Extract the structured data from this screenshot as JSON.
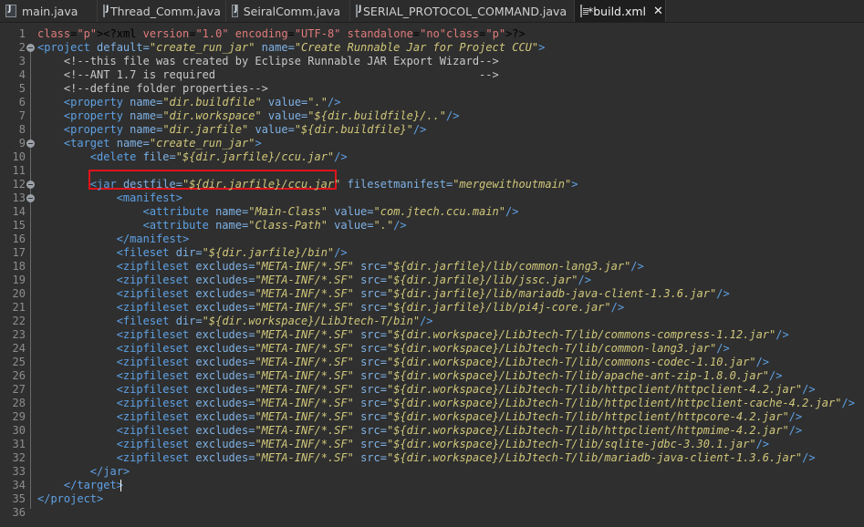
{
  "tabs": [
    {
      "label": "main.java",
      "icon": "java-file-icon"
    },
    {
      "label": "Thread_Comm.java",
      "icon": "java-file-icon"
    },
    {
      "label": "SeiralComm.java",
      "icon": "java-file-icon"
    },
    {
      "label": "SERIAL_PROTOCOL_COMMAND.java",
      "icon": "java-file-icon"
    },
    {
      "label": "*build.xml",
      "icon": "xml-file-icon",
      "active": true
    }
  ],
  "lines": [
    {
      "n": "1",
      "code": "<?xml version=\"1.0\" encoding=\"UTF-8\" standalone=\"no\"?>"
    },
    {
      "n": "2",
      "code": "<project default=\"create_run_jar\" name=\"Create Runnable Jar for Project CCU\">"
    },
    {
      "n": "3",
      "code": "    <!--this file was created by Eclipse Runnable JAR Export Wizard-->"
    },
    {
      "n": "4",
      "code": "    <!--ANT 1.7 is required                                        -->"
    },
    {
      "n": "5",
      "code": "    <!--define folder properties-->"
    },
    {
      "n": "6",
      "code": "    <property name=\"dir.buildfile\" value=\".\"/>"
    },
    {
      "n": "7",
      "code": "    <property name=\"dir.workspace\" value=\"${dir.buildfile}/..\"/>"
    },
    {
      "n": "8",
      "code": "    <property name=\"dir.jarfile\" value=\"${dir.buildfile}\"/>"
    },
    {
      "n": "9",
      "code": "    <target name=\"create_run_jar\">"
    },
    {
      "n": "10",
      "code": "        <delete file=\"${dir.jarfile}/ccu.jar\"/>"
    },
    {
      "n": "11",
      "code": ""
    },
    {
      "n": "12",
      "code": "        <jar destfile=\"${dir.jarfile}/ccu.jar\" filesetmanifest=\"mergewithoutmain\">"
    },
    {
      "n": "13",
      "code": "            <manifest>"
    },
    {
      "n": "14",
      "code": "                <attribute name=\"Main-Class\" value=\"com.jtech.ccu.main\"/>"
    },
    {
      "n": "15",
      "code": "                <attribute name=\"Class-Path\" value=\".\"/>"
    },
    {
      "n": "16",
      "code": "            </manifest>"
    },
    {
      "n": "17",
      "code": "            <fileset dir=\"${dir.jarfile}/bin\"/>"
    },
    {
      "n": "18",
      "code": "            <zipfileset excludes=\"META-INF/*.SF\" src=\"${dir.jarfile}/lib/common-lang3.jar\"/>"
    },
    {
      "n": "19",
      "code": "            <zipfileset excludes=\"META-INF/*.SF\" src=\"${dir.jarfile}/lib/jssc.jar\"/>"
    },
    {
      "n": "20",
      "code": "            <zipfileset excludes=\"META-INF/*.SF\" src=\"${dir.jarfile}/lib/mariadb-java-client-1.3.6.jar\"/>"
    },
    {
      "n": "21",
      "code": "            <zipfileset excludes=\"META-INF/*.SF\" src=\"${dir.jarfile}/lib/pi4j-core.jar\"/>"
    },
    {
      "n": "22",
      "code": "            <fileset dir=\"${dir.workspace}/LibJtech-T/bin\"/>"
    },
    {
      "n": "23",
      "code": "            <zipfileset excludes=\"META-INF/*.SF\" src=\"${dir.workspace}/LibJtech-T/lib/commons-compress-1.12.jar\"/>"
    },
    {
      "n": "24",
      "code": "            <zipfileset excludes=\"META-INF/*.SF\" src=\"${dir.workspace}/LibJtech-T/lib/common-lang3.jar\"/>"
    },
    {
      "n": "25",
      "code": "            <zipfileset excludes=\"META-INF/*.SF\" src=\"${dir.workspace}/LibJtech-T/lib/commons-codec-1.10.jar\"/>"
    },
    {
      "n": "26",
      "code": "            <zipfileset excludes=\"META-INF/*.SF\" src=\"${dir.workspace}/LibJtech-T/lib/apache-ant-zip-1.8.0.jar\"/>"
    },
    {
      "n": "27",
      "code": "            <zipfileset excludes=\"META-INF/*.SF\" src=\"${dir.workspace}/LibJtech-T/lib/httpclient/httpclient-4.2.jar\"/>"
    },
    {
      "n": "28",
      "code": "            <zipfileset excludes=\"META-INF/*.SF\" src=\"${dir.workspace}/LibJtech-T/lib/httpclient/httpclient-cache-4.2.jar\"/>"
    },
    {
      "n": "29",
      "code": "            <zipfileset excludes=\"META-INF/*.SF\" src=\"${dir.workspace}/LibJtech-T/lib/httpclient/httpcore-4.2.jar\"/>"
    },
    {
      "n": "30",
      "code": "            <zipfileset excludes=\"META-INF/*.SF\" src=\"${dir.workspace}/LibJtech-T/lib/httpclient/httpmime-4.2.jar\"/>"
    },
    {
      "n": "31",
      "code": "            <zipfileset excludes=\"META-INF/*.SF\" src=\"${dir.workspace}/LibJtech-T/lib/sqlite-jdbc-3.30.1.jar\"/>"
    },
    {
      "n": "32",
      "code": "            <zipfileset excludes=\"META-INF/*.SF\" src=\"${dir.workspace}/LibJtech-T/lib/mariadb-java-client-1.3.6.jar\"/>"
    },
    {
      "n": "33",
      "code": "        </jar>"
    },
    {
      "n": "34",
      "code": "    </target>"
    },
    {
      "n": "35",
      "code": "</project>"
    },
    {
      "n": "36",
      "code": ""
    }
  ],
  "colors": {
    "tag": "#5ea1e4",
    "attr": "#7fb2e6",
    "value": "#d0c77a",
    "comment": "#c8c8c8",
    "highlight": "#e0141c"
  }
}
